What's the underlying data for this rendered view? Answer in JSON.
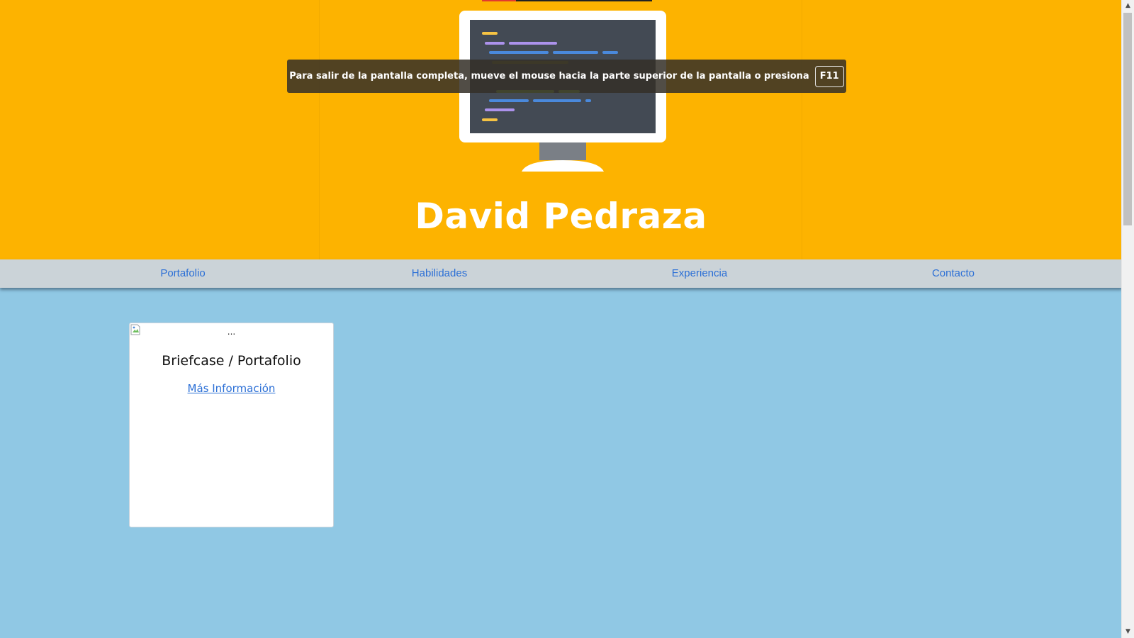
{
  "hero": {
    "name": "David Pedraza",
    "background_color": "#fdb300",
    "illustration": "monitor-code-icon"
  },
  "fullscreen_toast": {
    "message": "Para salir de la pantalla completa, mueve el mouse hacia la parte superior de la pantalla o presiona",
    "key": "F11"
  },
  "navbar": {
    "items": [
      {
        "label": "Portafolio"
      },
      {
        "label": "Habilidades"
      },
      {
        "label": "Experiencia"
      },
      {
        "label": "Contacto"
      }
    ],
    "link_color": "#2b6fd6"
  },
  "card": {
    "image_alt": "...",
    "title": "Briefcase / Portafolio",
    "link_label": "Más Información"
  },
  "colors": {
    "page_background": "#90c8e4",
    "navbar_background": "#cbd3d8"
  }
}
